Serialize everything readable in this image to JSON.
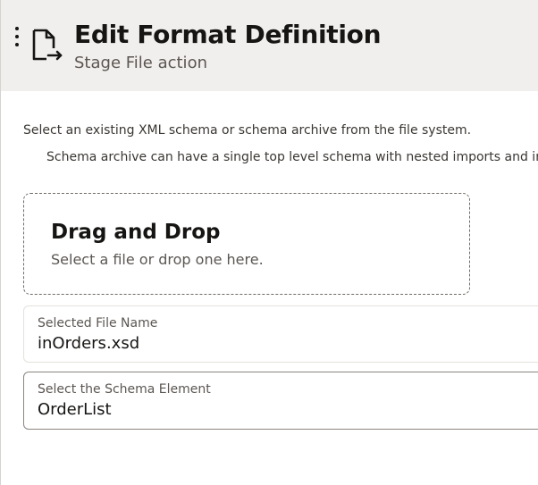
{
  "header": {
    "title": "Edit Format Definition",
    "subtitle": "Stage File action",
    "menu_icon": "kebab-menu-icon",
    "page_icon": "document-arrow-icon"
  },
  "instructions": {
    "line1": "Select an existing XML schema or schema archive from the file system.",
    "line2": "Schema archive can have a single top level schema with nested imports and inc"
  },
  "dropzone": {
    "title": "Drag and Drop",
    "hint": "Select a file or drop one here."
  },
  "selected_file": {
    "label": "Selected File Name",
    "value": "inOrders.xsd"
  },
  "schema_element": {
    "label": "Select the Schema Element",
    "value": "OrderList"
  },
  "colors": {
    "header_bg": "#f1efed",
    "text_primary": "#161513",
    "text_secondary": "#5b5652"
  }
}
